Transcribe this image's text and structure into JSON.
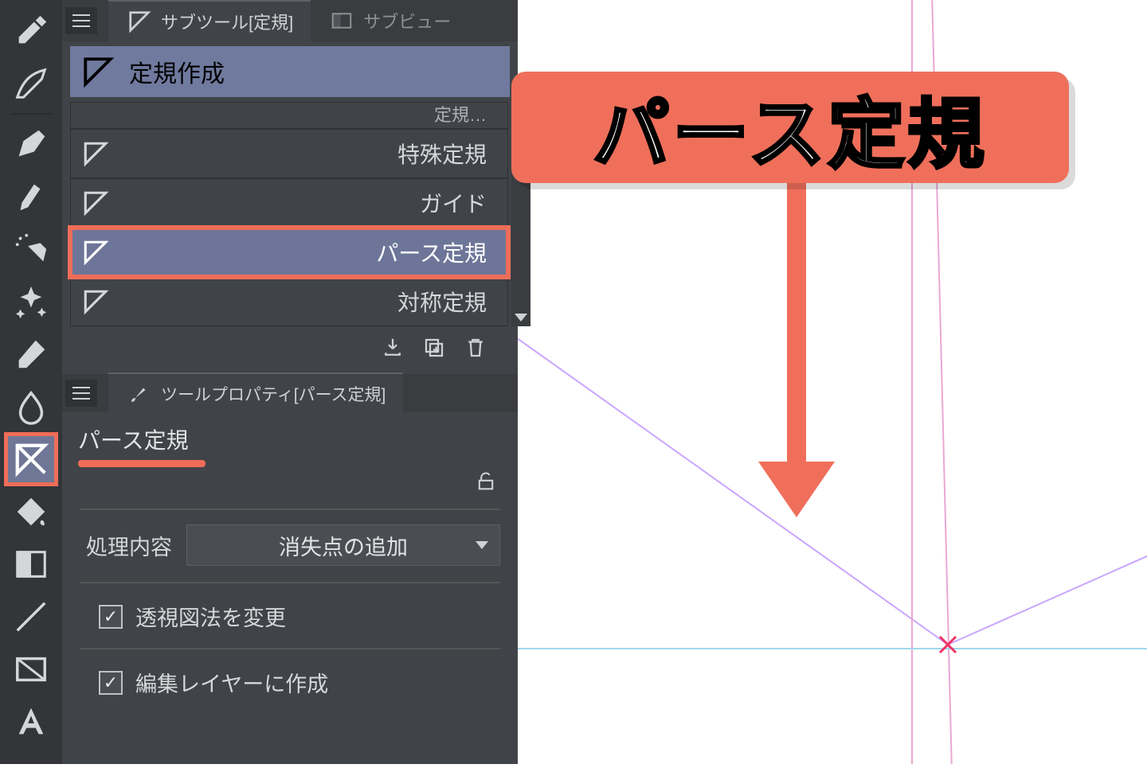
{
  "annotation": {
    "callout": "パース定規"
  },
  "tabs": {
    "subtool": "サブツール[定規]",
    "subview": "サブビュー"
  },
  "category": {
    "label": "定規作成"
  },
  "subtools": {
    "truncated": "定規…",
    "special": "特殊定規",
    "guide": "ガイド",
    "perspective": "パース定規",
    "symmetry": "対称定規"
  },
  "tool_property": {
    "tab": "ツールプロパティ[パース定規]",
    "name": "パース定規",
    "process_label": "処理内容",
    "process_value": "消失点の追加",
    "opt_change_perspective": "透視図法を変更",
    "opt_create_on_edit_layer": "編集レイヤーに作成"
  }
}
